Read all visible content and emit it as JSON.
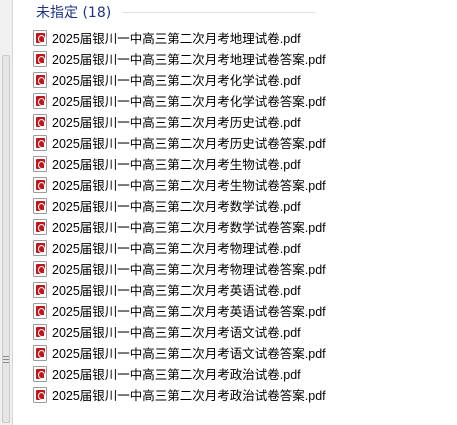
{
  "group": {
    "title": "未指定 (18)"
  },
  "files": [
    {
      "name": "2025届银川一中高三第二次月考地理试卷.pdf",
      "icon": "pdf-file-icon"
    },
    {
      "name": "2025届银川一中高三第二次月考地理试卷答案.pdf",
      "icon": "pdf-file-icon"
    },
    {
      "name": "2025届银川一中高三第二次月考化学试卷.pdf",
      "icon": "pdf-file-icon"
    },
    {
      "name": "2025届银川一中高三第二次月考化学试卷答案.pdf",
      "icon": "pdf-file-icon"
    },
    {
      "name": "2025届银川一中高三第二次月考历史试卷.pdf",
      "icon": "pdf-file-icon"
    },
    {
      "name": "2025届银川一中高三第二次月考历史试卷答案.pdf",
      "icon": "pdf-file-icon"
    },
    {
      "name": "2025届银川一中高三第二次月考生物试卷.pdf",
      "icon": "pdf-file-icon"
    },
    {
      "name": "2025届银川一中高三第二次月考生物试卷答案.pdf",
      "icon": "pdf-file-icon"
    },
    {
      "name": "2025届银川一中高三第二次月考数学试卷.pdf",
      "icon": "pdf-file-icon"
    },
    {
      "name": "2025届银川一中高三第二次月考数学试卷答案.pdf",
      "icon": "pdf-file-icon"
    },
    {
      "name": "2025届银川一中高三第二次月考物理试卷.pdf",
      "icon": "pdf-file-icon"
    },
    {
      "name": "2025届银川一中高三第二次月考物理试卷答案.pdf",
      "icon": "pdf-file-icon"
    },
    {
      "name": "2025届银川一中高三第二次月考英语试卷.pdf",
      "icon": "pdf-file-icon"
    },
    {
      "name": "2025届银川一中高三第二次月考英语试卷答案.pdf",
      "icon": "pdf-file-icon"
    },
    {
      "name": "2025届银川一中高三第二次月考语文试卷.pdf",
      "icon": "pdf-file-icon"
    },
    {
      "name": "2025届银川一中高三第二次月考语文试卷答案.pdf",
      "icon": "pdf-file-icon"
    },
    {
      "name": "2025届银川一中高三第二次月考政治试卷.pdf",
      "icon": "pdf-file-icon"
    },
    {
      "name": "2025届银川一中高三第二次月考政治试卷答案.pdf",
      "icon": "pdf-file-icon"
    }
  ],
  "colors": {
    "group_header": "#1e3287",
    "pdf_red": "#c2141b"
  }
}
